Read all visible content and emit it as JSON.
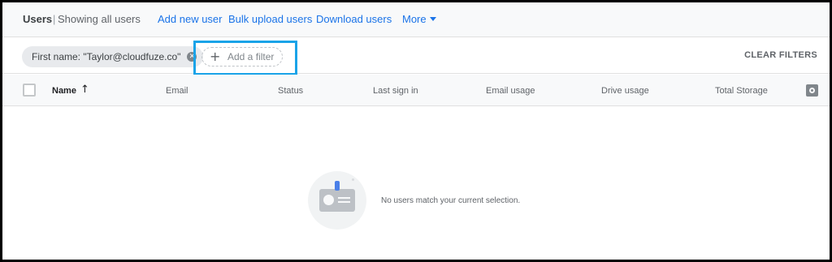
{
  "topbar": {
    "title": "Users",
    "separator": "|",
    "subtitle": "Showing all users",
    "links": {
      "add_new_user": "Add new user",
      "bulk_upload": "Bulk upload users",
      "download": "Download users",
      "more": "More"
    }
  },
  "filters": {
    "chip_label": "First name: \"Taylor@cloudfuze.co\"",
    "add_filter_label": "Add a filter",
    "clear_label": "CLEAR FILTERS"
  },
  "table": {
    "columns": {
      "name": "Name",
      "email": "Email",
      "status": "Status",
      "last_sign_in": "Last sign in",
      "email_usage": "Email usage",
      "drive_usage": "Drive usage",
      "total_storage": "Total Storage"
    },
    "sort_icon": "arrow-up-icon",
    "settings_icon": "gear-icon"
  },
  "empty_state": {
    "message": "No users match your current selection."
  },
  "colors": {
    "link": "#1a73e8",
    "highlight": "#1aa3e8",
    "chip_bg": "#e8eaed"
  }
}
